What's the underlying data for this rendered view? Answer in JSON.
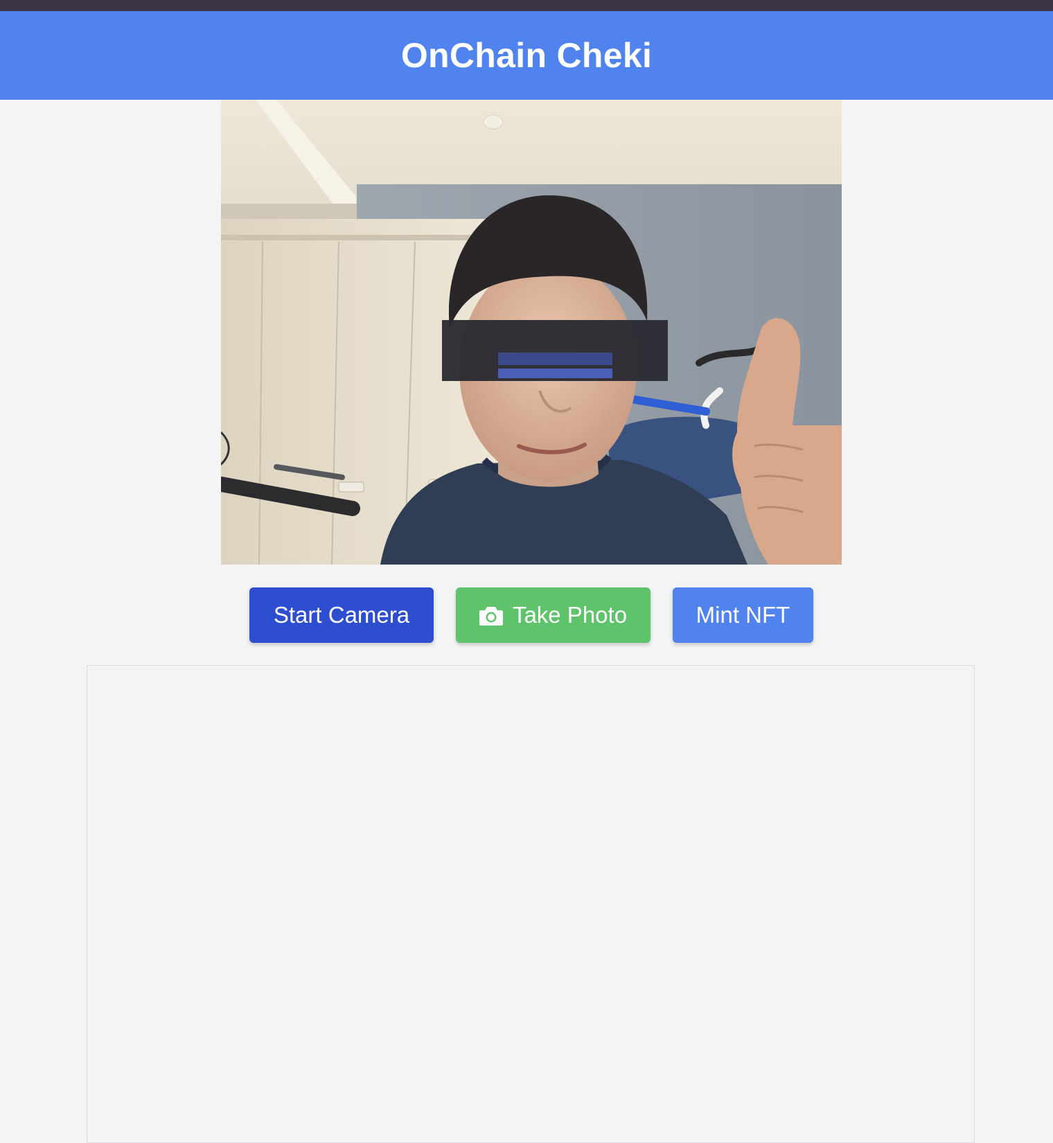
{
  "header": {
    "title": "OnChain Cheki",
    "background_color": "#5083ee"
  },
  "camera": {
    "feed_description": "live camera preview"
  },
  "controls": {
    "start_camera_label": "Start Camera",
    "take_photo_label": "Take Photo",
    "take_photo_icon": "camera-icon",
    "mint_nft_label": "Mint NFT",
    "colors": {
      "start_camera": "#2c4ecf",
      "take_photo": "#5fc36b",
      "mint_nft": "#5083ee"
    }
  }
}
